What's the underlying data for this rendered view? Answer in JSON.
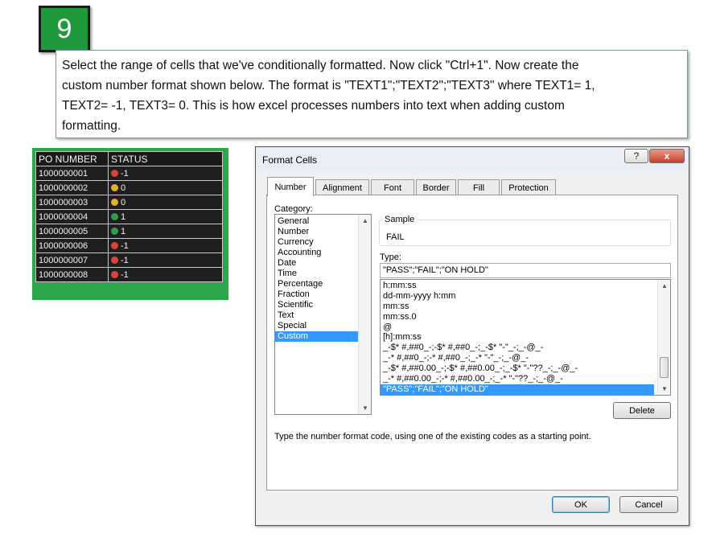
{
  "step": {
    "number": "9"
  },
  "instruction": {
    "lines": [
      "Select the range of cells that we've conditionally formatted. Now click \"Ctrl+1\".  Now create the",
      "custom number format shown below.  The format is \"TEXT1\";\"TEXT2\";\"TEXT3\" where TEXT1= 1,",
      "TEXT2= -1, TEXT3= 0. This is how excel processes numbers into text when adding custom",
      "formatting."
    ]
  },
  "sheet": {
    "headers": [
      "PO NUMBER",
      "STATUS"
    ],
    "rows": [
      {
        "po": "1000000001",
        "status": "-1"
      },
      {
        "po": "1000000002",
        "status": "0"
      },
      {
        "po": "1000000003",
        "status": "0"
      },
      {
        "po": "1000000004",
        "status": "1"
      },
      {
        "po": "1000000005",
        "status": "1"
      },
      {
        "po": "1000000006",
        "status": "-1"
      },
      {
        "po": "1000000007",
        "status": "-1"
      },
      {
        "po": "1000000008",
        "status": "-1"
      }
    ],
    "colors": {
      "red": "#d9453a",
      "yellow": "#e3b02a",
      "green": "#2f9e4b",
      "frame": "#2aa84a"
    }
  },
  "dialog": {
    "title": "Format Cells",
    "help_button": "?",
    "close_button": "x",
    "tabs": [
      "Number",
      "Alignment",
      "Font",
      "Border",
      "Fill",
      "Protection"
    ],
    "active_tab": "Number",
    "category_label": "Category:",
    "categories": [
      "General",
      "Number",
      "Currency",
      "Accounting",
      "Date",
      "Time",
      "Percentage",
      "Fraction",
      "Scientific",
      "Text",
      "Special",
      "Custom"
    ],
    "selected_category": "Custom",
    "sample_label": "Sample",
    "sample_value": "FAIL",
    "type_label": "Type:",
    "type_value": "\"PASS\";\"FAIL\";\"ON HOLD\"",
    "formats": [
      "h:mm:ss",
      "dd-mm-yyyy h:mm",
      "mm:ss",
      "mm:ss.0",
      "@",
      "[h]:mm:ss",
      "_-$* #,##0_-;-$* #,##0_-;_-$* \"-\"_-;_-@_-",
      "_-* #,##0_-;-* #,##0_-;_-* \"-\"_-;_-@_-",
      "_-$* #,##0.00_-;-$* #,##0.00_-;_-$* \"-\"??_-;_-@_-",
      "_-* #,##0.00_-;-* #,##0.00_-;_-* \"-\"??_-;_-@_-",
      "\"PASS\";\"FAIL\";\"ON HOLD\""
    ],
    "selected_format": "\"PASS\";\"FAIL\";\"ON HOLD\"",
    "delete_button": "Delete",
    "help_text": "Type the number format code, using one of the existing codes as a starting point.",
    "ok_button": "OK",
    "cancel_button": "Cancel",
    "selection_color": "#3399ff"
  }
}
